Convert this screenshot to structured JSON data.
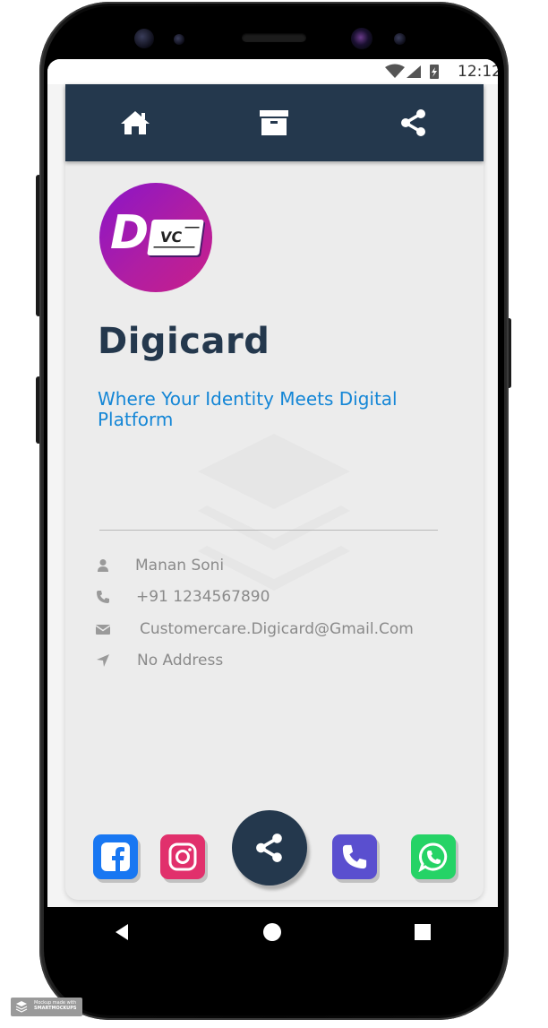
{
  "status_bar": {
    "time": "12:12"
  },
  "top_nav": {
    "items": [
      "home",
      "archive",
      "share"
    ]
  },
  "card": {
    "logo": {
      "letter": "D",
      "badge": "VC"
    },
    "title": "Digicard",
    "tagline": "Where Your Identity Meets Digital Platform"
  },
  "contact": {
    "name": "Manan Soni",
    "phone": "+91 1234567890",
    "email": "Customercare.Digicard@Gmail.Com",
    "address": "No Address"
  },
  "social": {
    "buttons": [
      "facebook",
      "instagram",
      "share",
      "phone",
      "whatsapp"
    ]
  },
  "colors": {
    "nav_bg": "#24384d",
    "tagline": "#1486d6",
    "facebook": "#1877f2",
    "instagram": "#e1306c",
    "phone": "#5a4fcf",
    "whatsapp": "#25d366"
  },
  "mockup_badge": {
    "line1": "Mockup made with",
    "line2": "SMARTMOCKUPS"
  }
}
